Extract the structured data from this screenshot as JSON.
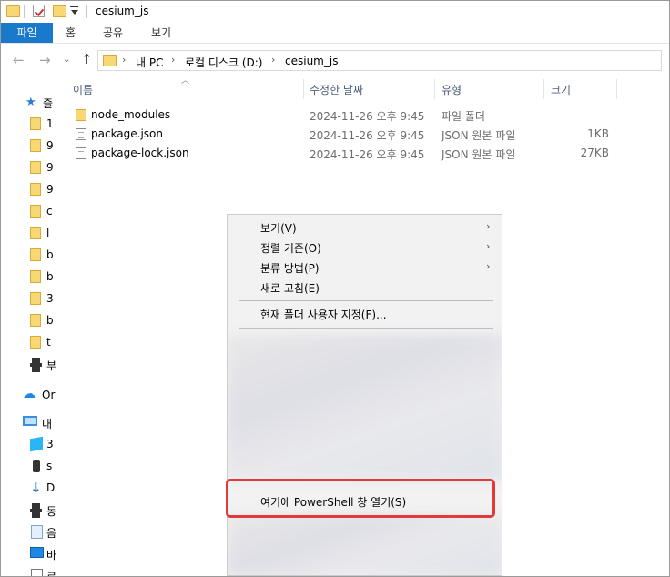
{
  "window": {
    "title": "cesium_js"
  },
  "ribbon": {
    "tabs": [
      "파일",
      "홈",
      "공유",
      "보기"
    ]
  },
  "address": {
    "path": [
      "내 PC",
      "로컬 디스크 (D:)",
      "cesium_js"
    ]
  },
  "nav_pane": {
    "quick_access_label": "즐",
    "items": [
      "1",
      "9",
      "9",
      "9",
      "c",
      "l",
      "b",
      "b",
      "3",
      "b",
      "t",
      "부"
    ],
    "onedrive_label": "Or",
    "this_pc_label": "내",
    "pc_items": [
      "3",
      "s",
      "D",
      "동",
      "음",
      "바",
      "로"
    ]
  },
  "columns": {
    "name": "이름",
    "modified": "수정한 날짜",
    "type": "유형",
    "size": "크기"
  },
  "files": [
    {
      "name": "node_modules",
      "modified": "2024-11-26 오후 9:45",
      "type": "파일 폴더",
      "size": "",
      "icon": "folder-icon"
    },
    {
      "name": "package.json",
      "modified": "2024-11-26 오후 9:45",
      "type": "JSON 원본 파일",
      "size": "1KB",
      "icon": "json-file-icon"
    },
    {
      "name": "package-lock.json",
      "modified": "2024-11-26 오후 9:45",
      "type": "JSON 원본 파일",
      "size": "27KB",
      "icon": "json-file-icon"
    }
  ],
  "context_menu": {
    "view": "보기(V)",
    "sort_by": "정렬 기준(O)",
    "group_by": "분류 방법(P)",
    "refresh": "새로 고침(E)",
    "customize": "현재 폴더 사용자 지정(F)...",
    "powershell": "여기에 PowerShell 창 열기(S)"
  },
  "colors": {
    "file_tab": "#1979ca",
    "highlight": "#e03a3a",
    "folder": "#f8d775"
  }
}
